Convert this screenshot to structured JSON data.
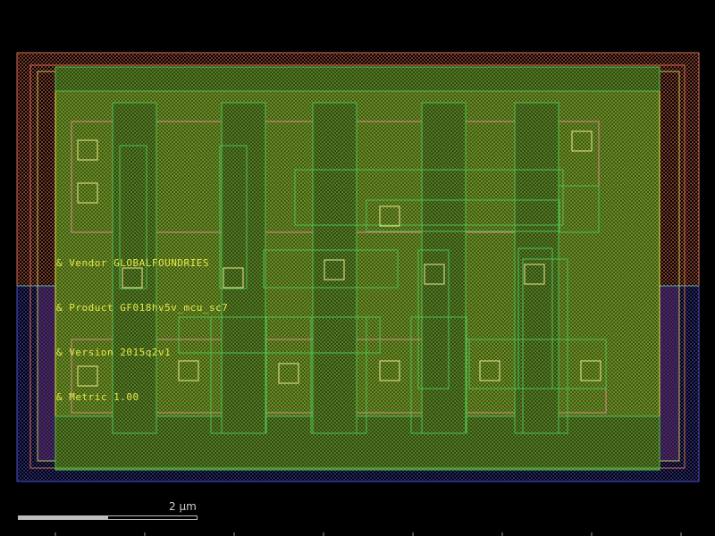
{
  "labels": [
    "& Vendor GLOBALFOUNDRIES",
    "& Product GF018hv5v_mcu_sc7",
    "& Version 2015q2v1",
    "& Metric 1.00"
  ],
  "scale_bar": {
    "text": "2 μm",
    "fill_fraction": 0.5
  },
  "colors": {
    "background": "#000000",
    "nwell": "#d86a52",
    "pwell": "#3a3aa0",
    "diffusion": "#3fbf3f",
    "poly": "#d83a3a",
    "metal": "#e0e040",
    "contact": "#f0e68c",
    "text": "#e8e84a"
  }
}
